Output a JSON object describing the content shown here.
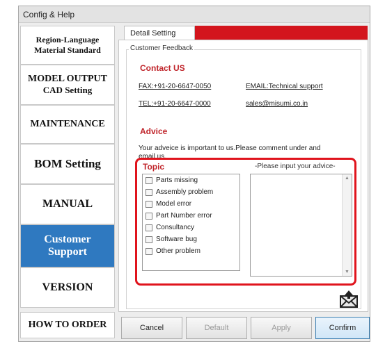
{
  "window": {
    "title": "Config & Help"
  },
  "sidebar": {
    "items": [
      {
        "lines": [
          "Region-Language",
          "Material Standard"
        ]
      },
      {
        "lines": [
          "MODEL OUTPUT",
          "CAD Setting"
        ]
      },
      {
        "lines": [
          "MAINTENANCE"
        ]
      },
      {
        "lines": [
          "BOM Setting"
        ]
      },
      {
        "lines": [
          "MANUAL"
        ]
      },
      {
        "lines": [
          "Customer",
          "Support"
        ],
        "active": true
      },
      {
        "lines": [
          "VERSION"
        ]
      },
      {
        "lines": [
          "HOW TO ORDER"
        ]
      }
    ]
  },
  "main": {
    "tab_label": "Detail Setting",
    "group_label": "Customer Feedback",
    "contact": {
      "heading": "Contact US",
      "fax": "FAX:+91-20-6647-0050",
      "email": "EMAIL:Technical support",
      "tel": "TEL:+91-20-6647-0000",
      "sales_email": "sales@misumi.co.in"
    },
    "advice": {
      "heading": "Advice",
      "description_line1": "Your adveice is important to us.Please comment under and",
      "description_line2": "email us.",
      "topic_title": "Topic",
      "input_label": "-Please input your advice-",
      "topics": [
        "Parts missing",
        "Assembly problem",
        "Model error",
        "Part Number error",
        "Consultancy",
        "Software bug",
        "Other problem"
      ],
      "input_value": ""
    }
  },
  "footer": {
    "cancel_label": "Cancel",
    "default_label": "Default",
    "apply_label": "Apply",
    "confirm_label": "Confirm"
  },
  "colors": {
    "accent_red": "#d3151d",
    "active_blue": "#2f79c0",
    "highlight_red": "#e0141d"
  },
  "icons": {
    "send": "envelope-upload-icon"
  }
}
